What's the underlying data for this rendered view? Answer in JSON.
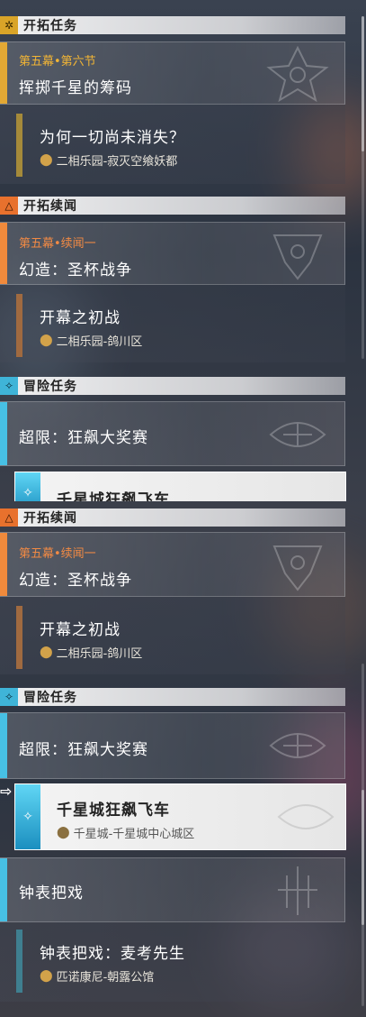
{
  "colors": {
    "gold": "#e3a834",
    "orange": "#f08a3c",
    "cyan": "#47c0e4"
  },
  "panel1": {
    "header_trailblaze": {
      "icon": "✲",
      "label": "开拓任务"
    },
    "trailblaze_card": {
      "subtitle": "第五幕•第六节",
      "title": "挥掷千星的筹码",
      "emblem": "trailblaze-emblem-icon"
    },
    "trailblaze_sub": {
      "title": "为何一切尚未消失？",
      "location": "二相乐园-寂灭空飨妖都"
    },
    "header_companion": {
      "icon": "△",
      "label": "开拓续闻"
    },
    "companion_card": {
      "subtitle": "第五幕•续闻一",
      "title": "幻造：圣杯战争"
    },
    "companion_sub": {
      "title": "开幕之初战",
      "location": "二相乐园-鸽川区"
    },
    "header_adventure": {
      "icon": "✧",
      "label": "冒险任务"
    },
    "adventure_card": {
      "title": "超限：狂飙大奖赛"
    },
    "selected_partial": {
      "title": "千星城狂飙飞车"
    }
  },
  "panel2": {
    "header_companion": {
      "icon": "△",
      "label": "开拓续闻"
    },
    "companion_card": {
      "subtitle": "第五幕•续闻一",
      "title": "幻造：圣杯战争"
    },
    "companion_sub": {
      "title": "开幕之初战",
      "location": "二相乐园-鸽川区"
    },
    "header_adventure": {
      "icon": "✧",
      "label": "冒险任务"
    },
    "adventure_card": {
      "title": "超限：狂飙大奖赛"
    },
    "selected": {
      "arrow": "⇨",
      "title": "千星城狂飙飞车",
      "location": "千星城-千星城中心城区"
    },
    "clock_card": {
      "title": "钟表把戏"
    },
    "clock_sub": {
      "title": "钟表把戏：麦考先生",
      "location": "匹诺康尼-朝露公馆"
    }
  }
}
